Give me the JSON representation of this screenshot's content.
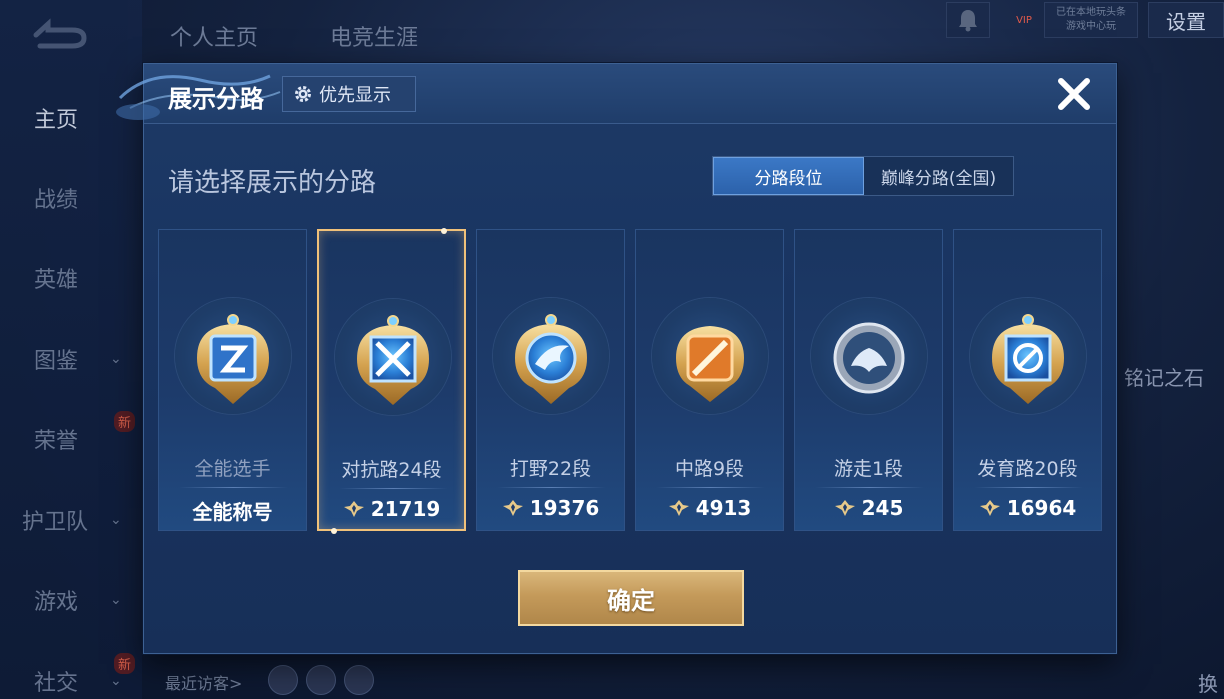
{
  "background": {
    "top_tabs": [
      "个人主页",
      "电竞生涯"
    ],
    "top_right": {
      "settings_label": "设置",
      "vip_label": "VIP",
      "status_line1": "已在本地玩头条",
      "status_line2": "游戏中心玩"
    },
    "sidebar": [
      {
        "label": "主页",
        "active": true,
        "chevron": false,
        "new": false
      },
      {
        "label": "战绩",
        "active": false,
        "chevron": false,
        "new": false
      },
      {
        "label": "英雄",
        "active": false,
        "chevron": false,
        "new": false
      },
      {
        "label": "图鉴",
        "active": false,
        "chevron": true,
        "new": false
      },
      {
        "label": "荣誉",
        "active": false,
        "chevron": false,
        "new": true
      },
      {
        "label": "护卫队",
        "active": false,
        "chevron": true,
        "new": false
      },
      {
        "label": "游戏",
        "active": false,
        "chevron": true,
        "new": false
      },
      {
        "label": "社交",
        "active": false,
        "chevron": true,
        "new": true
      }
    ],
    "new_badge": "新",
    "visitor_label": "最近访客>",
    "right_label": "铭记之石",
    "right_edge_label": "换"
  },
  "modal": {
    "title": "展示分路",
    "priority_label": "优先显示",
    "subtitle": "请选择展示的分路",
    "segment": {
      "active": "分路段位",
      "inactive": "巅峰分路(全国)"
    },
    "confirm_label": "确定"
  },
  "lanes": [
    {
      "name": "全能选手",
      "score": "全能称号",
      "has_score_icon": false,
      "selected": false,
      "icon": "all-round-badge-icon"
    },
    {
      "name": "对抗路24段",
      "score": "21719",
      "has_score_icon": true,
      "selected": true,
      "icon": "clash-lane-badge-icon"
    },
    {
      "name": "打野22段",
      "score": "19376",
      "has_score_icon": true,
      "selected": false,
      "icon": "jungle-badge-icon"
    },
    {
      "name": "中路9段",
      "score": "4913",
      "has_score_icon": true,
      "selected": false,
      "icon": "mid-lane-badge-icon"
    },
    {
      "name": "游走1段",
      "score": "245",
      "has_score_icon": true,
      "selected": false,
      "icon": "roam-badge-icon"
    },
    {
      "name": "发育路20段",
      "score": "16964",
      "has_score_icon": true,
      "selected": false,
      "icon": "farm-lane-badge-icon"
    }
  ],
  "colors": {
    "gold": "#d9b67a",
    "selected_border": "#f0c17a",
    "modal_bg": "#1b365f",
    "segment_active": "#3b78c6"
  }
}
